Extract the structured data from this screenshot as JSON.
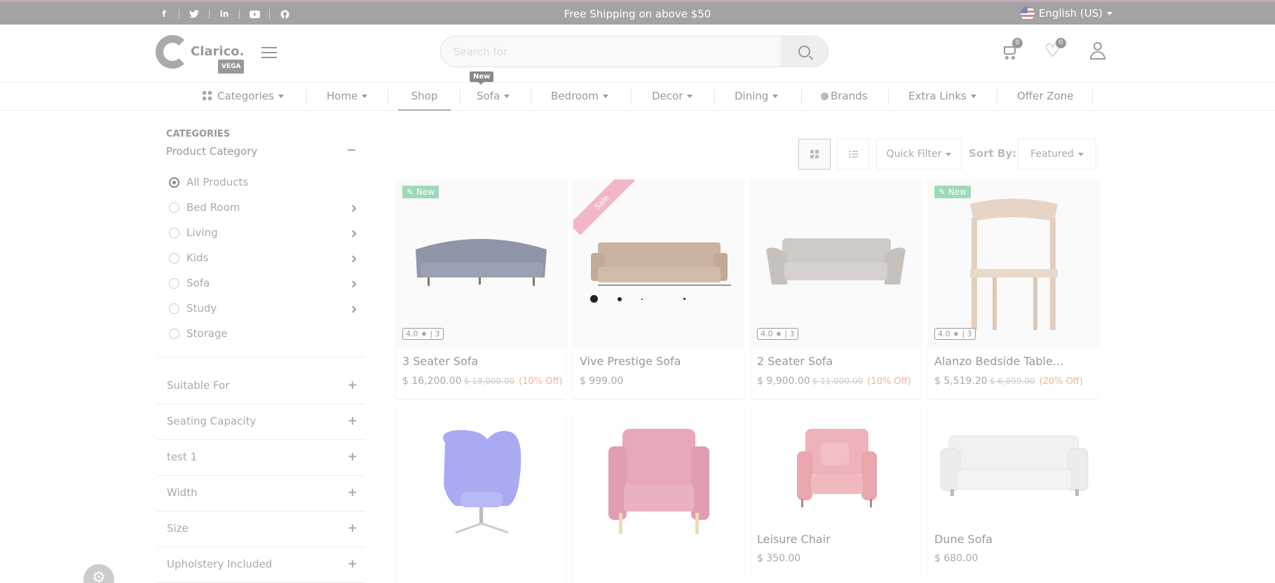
{
  "topbar": {
    "social_icons": [
      "facebook-icon",
      "twitter-icon",
      "linkedin-icon",
      "youtube-icon",
      "github-icon"
    ],
    "shipping_text": "Free Shipping on above $50",
    "language": "English (US)"
  },
  "header": {
    "logo_text": "Clarico.",
    "logo_sub": "VEGA",
    "search_placeholder": "Search for",
    "cart_count": "0",
    "wishlist_count": "0"
  },
  "nav": {
    "items": [
      "Categories",
      "Home",
      "Shop",
      "Sofa",
      "Bedroom",
      "Decor",
      "Dining",
      "Brands",
      "Extra Links",
      "Offer Zone"
    ],
    "new_tag": "New",
    "active": "Shop"
  },
  "sidebar": {
    "title": "CATEGORIES",
    "subtitle": "Product Category",
    "categories": [
      "All Products",
      "Bed Room",
      "Living",
      "Kids",
      "Sofa",
      "Study",
      "Storage"
    ],
    "selected": "All Products",
    "filters": [
      "Suitable For",
      "Seating Capacity",
      "test 1",
      "Width",
      "Size",
      "Upholstery Included"
    ]
  },
  "toolbar": {
    "quick_filter": "Quick Filter",
    "sort_label": "Sort By:",
    "sort_value": "Featured"
  },
  "products": [
    {
      "name": "3 Seater Sofa",
      "price": "$ 16,200.00",
      "old_price": "$ 18,000.00",
      "discount": "(10% Off)",
      "badge": "New",
      "rating": "4.0 ★ | 3"
    },
    {
      "name": "Vive Prestige Sofa",
      "price": "$ 999.00",
      "ribbon": "Sale"
    },
    {
      "name": "2 Seater Sofa",
      "price": "$ 9,900.00",
      "old_price": "$ 11,000.00",
      "discount": "(10% Off)",
      "rating": "4.0 ★ | 3"
    },
    {
      "name": "Alanzo Bedside Table...",
      "price": "$ 5,519.20",
      "old_price": "$ 6,899.00",
      "discount": "(20% Off)",
      "badge": "New",
      "rating": "4.0 ★ | 3"
    },
    {
      "name": "",
      "price": ""
    },
    {
      "name": "",
      "price": ""
    },
    {
      "name": "Leisure Chair",
      "price": "$ 350.00"
    },
    {
      "name": "Dune Sofa",
      "price": "$ 680.00"
    }
  ],
  "colors": {
    "topbar_bg": "#a3a3a3",
    "new_badge": "#9ed9ba",
    "discount": "#f5b38f"
  }
}
